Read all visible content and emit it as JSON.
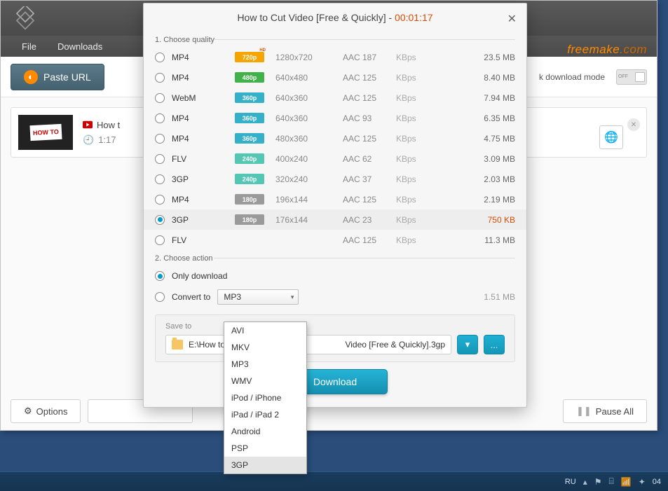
{
  "app": {
    "window_controls": {
      "min": "—",
      "max": "▢",
      "close": "✕"
    },
    "brand_a": "freemake",
    "brand_b": ".com",
    "menu": {
      "file": "File",
      "downloads": "Downloads"
    },
    "toolbar": {
      "paste": "Paste URL",
      "mode_suffix": "k download mode",
      "toggle_state": "OFF"
    },
    "item": {
      "title_partial": "How t",
      "duration": "1:17"
    },
    "bottom": {
      "options": "Options",
      "pause_all": "Pause All"
    }
  },
  "modal": {
    "title_a": "How to Cut Video [Free & Quickly] - ",
    "title_dur": "00:01:17",
    "sec1": "1. Choose quality",
    "sec2": "2. Choose action",
    "qualities": [
      {
        "fmt": "MP4",
        "badge": "720p",
        "bclass": "b720",
        "res": "1280x720",
        "codec": "AAC 187",
        "kbps": "KBps",
        "size": "23.5 MB",
        "sel": false,
        "apple": false
      },
      {
        "fmt": "MP4",
        "badge": "480p",
        "bclass": "b480",
        "res": "640x480",
        "codec": "AAC 125",
        "kbps": "KBps",
        "size": "8.40 MB",
        "sel": false,
        "apple": false
      },
      {
        "fmt": "WebM",
        "badge": "360p",
        "bclass": "b360",
        "res": "640x360",
        "codec": "AAC 125",
        "kbps": "KBps",
        "size": "7.94 MB",
        "sel": false,
        "apple": false
      },
      {
        "fmt": "MP4",
        "badge": "360p",
        "bclass": "b360",
        "res": "640x360",
        "codec": "AAC 93",
        "kbps": "KBps",
        "size": "6.35 MB",
        "sel": false,
        "apple": true
      },
      {
        "fmt": "MP4",
        "badge": "360p",
        "bclass": "b360",
        "res": "480x360",
        "codec": "AAC 125",
        "kbps": "KBps",
        "size": "4.75 MB",
        "sel": false,
        "apple": false
      },
      {
        "fmt": "FLV",
        "badge": "240p",
        "bclass": "b240",
        "res": "400x240",
        "codec": "AAC 62",
        "kbps": "KBps",
        "size": "3.09 MB",
        "sel": false,
        "apple": false
      },
      {
        "fmt": "3GP",
        "badge": "240p",
        "bclass": "b240",
        "res": "320x240",
        "codec": "AAC 37",
        "kbps": "KBps",
        "size": "2.03 MB",
        "sel": false,
        "apple": false
      },
      {
        "fmt": "MP4",
        "badge": "180p",
        "bclass": "b180",
        "res": "196x144",
        "codec": "AAC 125",
        "kbps": "KBps",
        "size": "2.19 MB",
        "sel": false,
        "apple": false
      },
      {
        "fmt": "3GP",
        "badge": "180p",
        "bclass": "b180",
        "res": "176x144",
        "codec": "AAC 23",
        "kbps": "KBps",
        "size": "750 KB",
        "sel": true,
        "apple": false
      },
      {
        "fmt": "FLV",
        "badge": "",
        "bclass": "empty",
        "res": "",
        "codec": "AAC 125",
        "kbps": "KBps",
        "size": "11.3 MB",
        "sel": false,
        "apple": false
      }
    ],
    "action": {
      "only": "Only download",
      "convert": "Convert to",
      "convert_value": "MP3",
      "convert_size": "1.51 MB",
      "selected": "only"
    },
    "dropdown_options": [
      "AVI",
      "MKV",
      "MP3",
      "WMV",
      "iPod / iPhone",
      "iPad / iPad 2",
      "Android",
      "PSP",
      "3GP"
    ],
    "dropdown_highlight": "3GP",
    "save": {
      "label": "Save to",
      "path_a": "E:\\How to",
      "path_b": "Video [Free & Quickly].3gp",
      "browse": "..."
    },
    "download": "Download"
  },
  "taskbar": {
    "lang": "RU",
    "time_partial": "04"
  }
}
